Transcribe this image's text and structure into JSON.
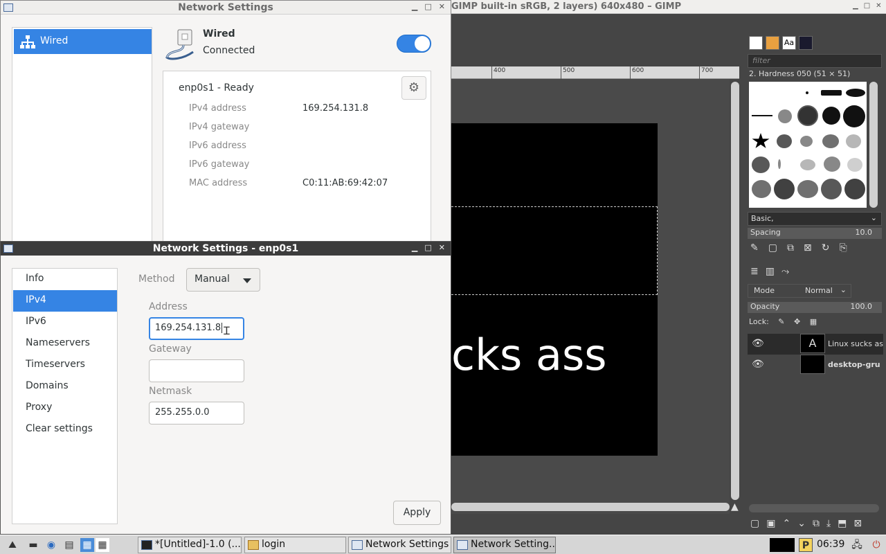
{
  "gimp": {
    "title": "GIMP built-in sRGB, 2 layers) 640x480 – GIMP",
    "ruler_labels": [
      "400",
      "500",
      "600",
      "700"
    ],
    "image_text": "cks ass",
    "dock": {
      "filter_placeholder": "filter",
      "brush_name": "2. Hardness 050 (51 × 51)",
      "preset": "Basic,",
      "spacing_label": "Spacing",
      "spacing_value": "10.0",
      "mode_label": "Mode",
      "mode_value": "Normal",
      "opacity_label": "Opacity",
      "opacity_value": "100.0",
      "lock_label": "Lock:",
      "layers": [
        {
          "name": "Linux sucks ass"
        },
        {
          "name": "desktop-gru"
        }
      ]
    }
  },
  "win1": {
    "title": "Network Settings",
    "sidebar": {
      "item": "Wired"
    },
    "header": {
      "title": "Wired",
      "status": "Connected",
      "enabled": true
    },
    "device": {
      "title": "enp0s1 - Ready",
      "props": [
        {
          "label": "IPv4 address",
          "value": "169.254.131.8"
        },
        {
          "label": "IPv4 gateway",
          "value": ""
        },
        {
          "label": "IPv6 address",
          "value": ""
        },
        {
          "label": "IPv6 gateway",
          "value": ""
        },
        {
          "label": "MAC address",
          "value": "C0:11:AB:69:42:07"
        }
      ]
    }
  },
  "win2": {
    "title": "Network Settings - enp0s1",
    "sidebar": [
      "Info",
      "IPv4",
      "IPv6",
      "Nameservers",
      "Timeservers",
      "Domains",
      "Proxy",
      "Clear settings"
    ],
    "selected": "IPv4",
    "method_label": "Method",
    "method_value": "Manual",
    "address_label": "Address",
    "address_value": "169.254.131.8",
    "gateway_label": "Gateway",
    "gateway_value": "",
    "netmask_label": "Netmask",
    "netmask_value": "255.255.0.0",
    "apply_label": "Apply"
  },
  "taskbar": {
    "tasks": [
      "*[Untitled]-1.0 (...",
      "login",
      "Network Settings",
      "Network Setting..."
    ],
    "clock": "06:39",
    "badge": "P"
  },
  "colors": {
    "accent": "#3584e4",
    "panel_bg": "#f6f5f4",
    "gimp_bg": "#454545"
  }
}
